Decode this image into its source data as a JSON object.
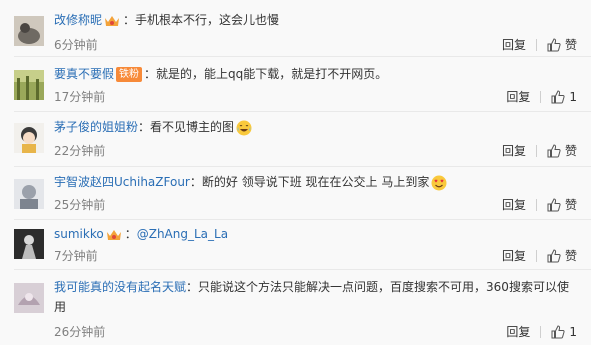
{
  "comments": [
    {
      "username": "改修称昵",
      "has_crown": true,
      "badge": "",
      "text": "手机根本不行，这会儿也慢",
      "mention": "",
      "emoji": "",
      "time": "6分钟前",
      "reply_label": "回复",
      "like_label": "赞"
    },
    {
      "username": "要真不要假",
      "has_crown": false,
      "badge": "铁粉",
      "text": "就是的，能上qq能下载，就是打不开网页。",
      "mention": "",
      "emoji": "",
      "time": "17分钟前",
      "reply_label": "回复",
      "like_label": "1"
    },
    {
      "username": "茅子俊的姐姐粉",
      "has_crown": false,
      "badge": "",
      "text": "看不见博主的图",
      "mention": "",
      "emoji": "tears-of-joy-emoji",
      "time": "22分钟前",
      "reply_label": "回复",
      "like_label": "赞"
    },
    {
      "username": "宇智波赵四UchihaZFour",
      "has_crown": false,
      "badge": "",
      "text": "断的好  领导说下班   现在在公交上  马上到家",
      "mention": "",
      "emoji": "heart-eyes-emoji",
      "time": "25分钟前",
      "reply_label": "回复",
      "like_label": "赞"
    },
    {
      "username": "sumikko",
      "has_crown": true,
      "badge": "",
      "text": "",
      "mention": "@ZhAng_La_La",
      "emoji": "",
      "time": "7分钟前",
      "reply_label": "回复",
      "like_label": "赞"
    },
    {
      "username": "我可能真的没有起名天赋",
      "has_crown": false,
      "badge": "",
      "text": "只能说这个方法只能解决一点问题，百度搜索不可用，360搜索可以使用",
      "mention": "",
      "emoji": "",
      "time": "26分钟前",
      "reply_label": "回复",
      "like_label": "1"
    }
  ],
  "colors": {
    "username": "#2a6eb5",
    "badge": "#f78a39",
    "time": "#808080"
  }
}
